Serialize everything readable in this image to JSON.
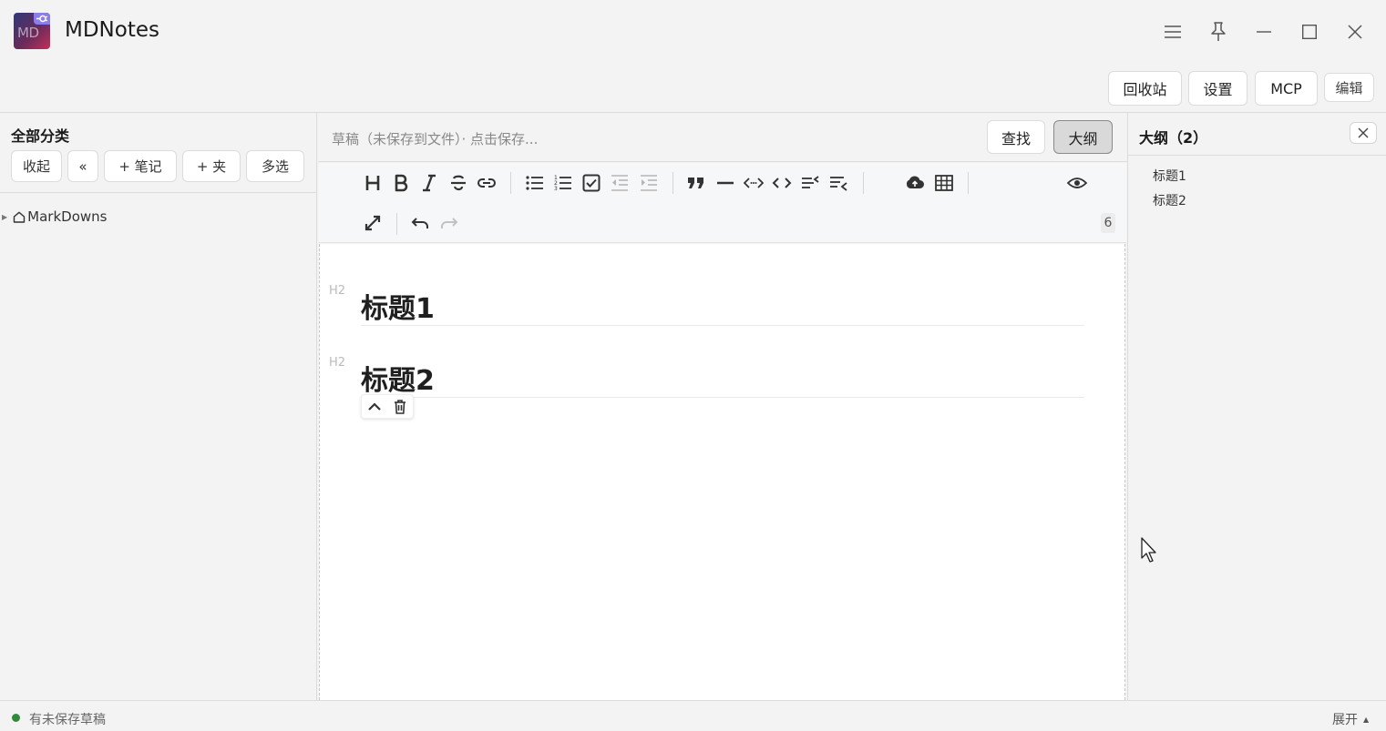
{
  "app": {
    "title": "MDNotes",
    "logo_text": "MD"
  },
  "actionbar": {
    "recycle_bin": "回收站",
    "settings": "设置",
    "mcp": "MCP",
    "edit": "编辑"
  },
  "sidebar": {
    "title": "全部分类",
    "buttons": {
      "collapse": "收起",
      "back": "«",
      "new_note": "+ 笔记",
      "new_folder": "+ 夹",
      "multi_select": "多选"
    },
    "tree": [
      {
        "label": "MarkDowns",
        "icon": "home-icon",
        "expanded": false
      }
    ]
  },
  "editor_header": {
    "draft_status": "草稿（未保存到文件）· 点击保存...",
    "find": "查找",
    "outline": "大纲"
  },
  "toolbar": {
    "icons": [
      "heading-icon",
      "bold-icon",
      "italic-icon",
      "strikethrough-icon",
      "link-icon",
      "bullet-list-icon",
      "ordered-list-icon",
      "checklist-icon",
      "outdent-icon",
      "indent-icon",
      "quote-icon",
      "horizontal-rule-icon",
      "inline-code-icon",
      "code-block-icon",
      "line-break-icon",
      "clear-format-icon",
      "upload-icon",
      "table-icon",
      "preview-eye-icon",
      "fullscreen-icon",
      "undo-icon",
      "redo-icon"
    ],
    "word_count": "6"
  },
  "editor": {
    "blocks": [
      {
        "marker": "H2",
        "text": "标题1"
      },
      {
        "marker": "H2",
        "text": "标题2"
      }
    ]
  },
  "outline": {
    "title": "大纲（2）",
    "items": [
      "标题1",
      "标题2"
    ]
  },
  "statusbar": {
    "status": "有未保存草稿",
    "status_color": "#2f8a3a",
    "expand": "展开",
    "expand_arrow": "▲"
  }
}
